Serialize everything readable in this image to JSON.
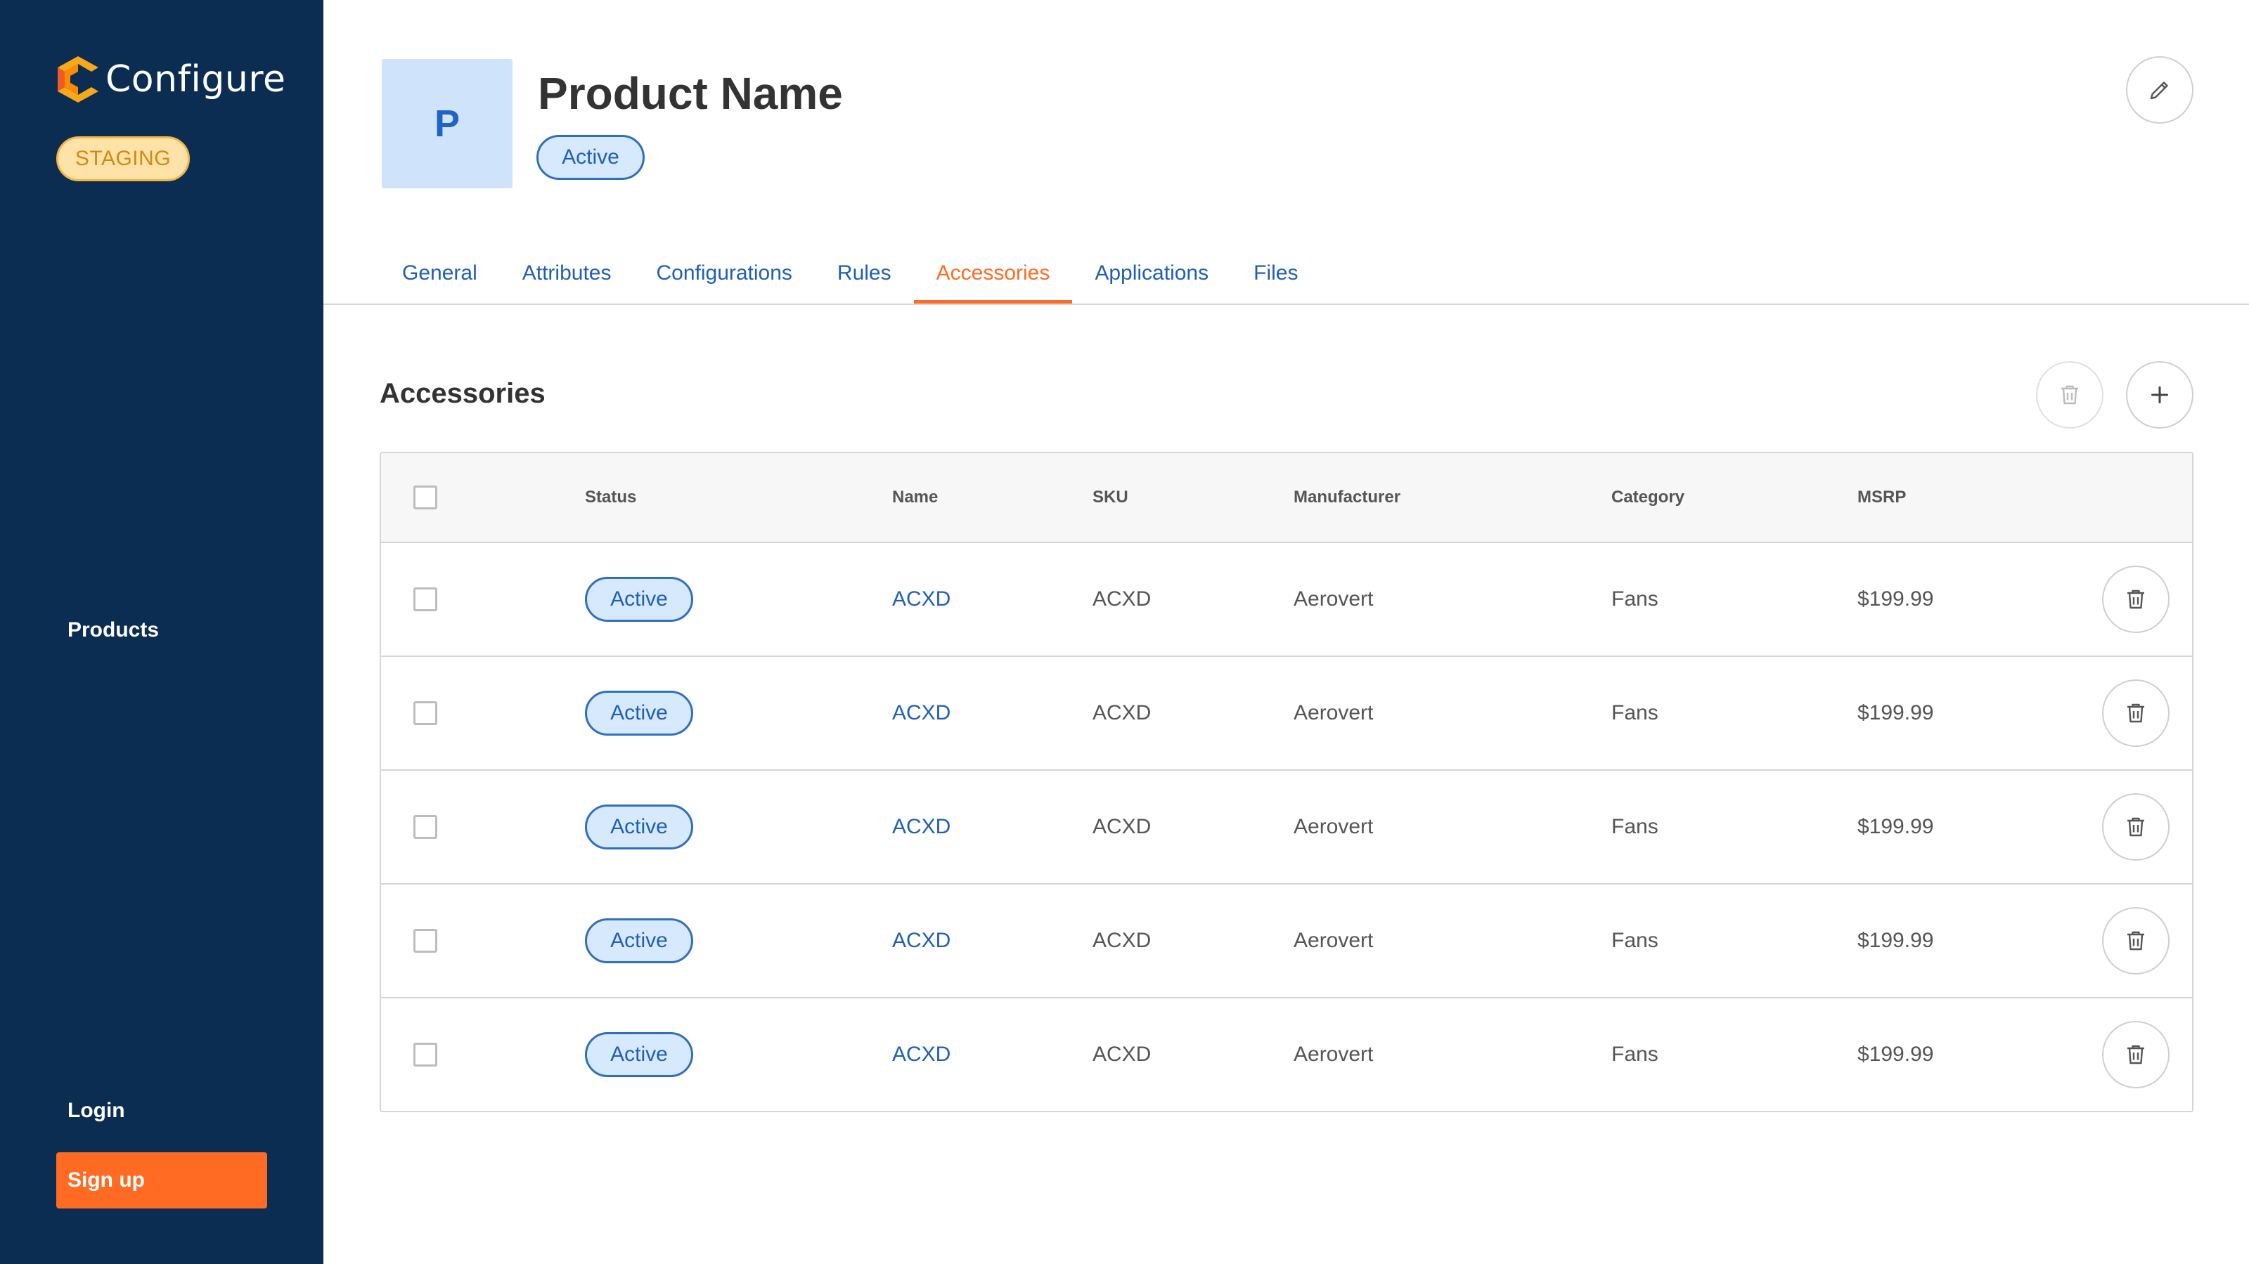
{
  "app": {
    "name": "Configure",
    "environment": "STAGING"
  },
  "sidebar": {
    "products_label": "Products",
    "login_label": "Login",
    "signup_label": "Sign up"
  },
  "product": {
    "avatar_letter": "P",
    "name": "Product Name",
    "status": "Active"
  },
  "tabs": [
    {
      "label": "General"
    },
    {
      "label": "Attributes"
    },
    {
      "label": "Configurations"
    },
    {
      "label": "Rules"
    },
    {
      "label": "Accessories"
    },
    {
      "label": "Applications"
    },
    {
      "label": "Files"
    }
  ],
  "active_tab": "Accessories",
  "section": {
    "title": "Accessories"
  },
  "table": {
    "headers": {
      "status": "Status",
      "name": "Name",
      "sku": "SKU",
      "manufacturer": "Manufacturer",
      "category": "Category",
      "msrp": "MSRP"
    },
    "rows": [
      {
        "status": "Active",
        "name": "ACXD",
        "sku": "ACXD",
        "manufacturer": "Aerovert",
        "category": "Fans",
        "msrp": "$199.99"
      },
      {
        "status": "Active",
        "name": "ACXD",
        "sku": "ACXD",
        "manufacturer": "Aerovert",
        "category": "Fans",
        "msrp": "$199.99"
      },
      {
        "status": "Active",
        "name": "ACXD",
        "sku": "ACXD",
        "manufacturer": "Aerovert",
        "category": "Fans",
        "msrp": "$199.99"
      },
      {
        "status": "Active",
        "name": "ACXD",
        "sku": "ACXD",
        "manufacturer": "Aerovert",
        "category": "Fans",
        "msrp": "$199.99"
      },
      {
        "status": "Active",
        "name": "ACXD",
        "sku": "ACXD",
        "manufacturer": "Aerovert",
        "category": "Fans",
        "msrp": "$199.99"
      }
    ]
  },
  "colors": {
    "sidebar": "#0b2d52",
    "accent": "#ff6b23",
    "link": "#1f5fb8",
    "badge_bg": "#d6e9fd",
    "staging_bg": "#ffe2a8"
  },
  "icons": {
    "edit": "pencil-icon",
    "delete": "trash-icon",
    "add": "plus-icon"
  }
}
